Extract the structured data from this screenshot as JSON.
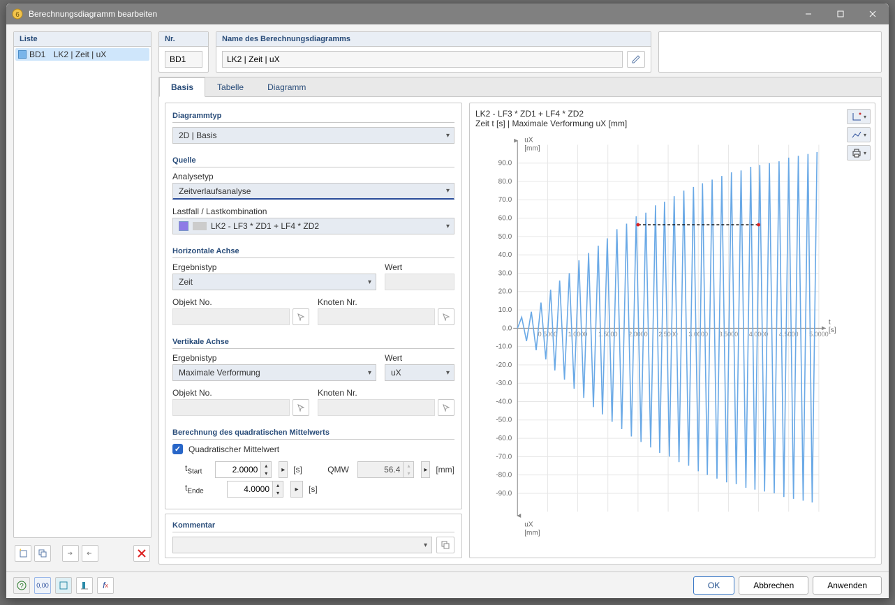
{
  "window": {
    "title": "Berechnungsdiagramm bearbeiten"
  },
  "list": {
    "title": "Liste",
    "items": [
      {
        "id": "BD1",
        "label": "LK2 | Zeit | uX"
      }
    ]
  },
  "nr": {
    "title": "Nr.",
    "value": "BD1"
  },
  "name": {
    "title": "Name des Berechnungsdiagramms",
    "value": "LK2 | Zeit | uX"
  },
  "tabs": {
    "basis": "Basis",
    "tabelle": "Tabelle",
    "diagramm": "Diagramm"
  },
  "sections": {
    "diagrammtyp": "Diagrammtyp",
    "quelle": "Quelle",
    "horiz": "Horizontale Achse",
    "vert": "Vertikale Achse",
    "rms": "Berechnung des quadratischen Mittelwerts",
    "kommentar": "Kommentar"
  },
  "fields": {
    "chart_type": "2D | Basis",
    "analysetyp_lbl": "Analysetyp",
    "analysetyp": "Zeitverlaufsanalyse",
    "lastfall_lbl": "Lastfall / Lastkombination",
    "lastfall": "LK2 - LF3 * ZD1 + LF4 * ZD2",
    "ergebnistyp_lbl": "Ergebnistyp",
    "wert_lbl": "Wert",
    "objekt_lbl": "Objekt No.",
    "knoten_lbl": "Knoten Nr.",
    "h_ergebnis": "Zeit",
    "v_ergebnis": "Maximale Verformung",
    "v_wert": "uX"
  },
  "rms": {
    "chk_label": "Quadratischer Mittelwert",
    "tstart_lbl": "t_Start",
    "tstart": "2.0000",
    "tende_lbl": "t_Ende",
    "tende": "4.0000",
    "unit_s": "[s]",
    "qmw_lbl": "QMW",
    "qmw_val": "56.4",
    "unit_mm": "[mm]"
  },
  "chart": {
    "title": "LK2 - LF3 * ZD1 + LF4 * ZD2",
    "subtitle": "Zeit t [s] | Maximale Verformung uX [mm]",
    "y_label_top": "uX",
    "y_unit": "[mm]",
    "x_label": "t",
    "x_unit": "[s]"
  },
  "footer": {
    "ok": "OK",
    "cancel": "Abbrechen",
    "apply": "Anwenden"
  },
  "chart_data": {
    "type": "line",
    "title": "LK2 - LF3 * ZD1 + LF4 * ZD2",
    "xlabel": "t [s]",
    "ylabel": "uX [mm]",
    "ylim": [
      -100,
      100
    ],
    "xlim": [
      0,
      5
    ],
    "xticks": [
      0.5,
      1.0,
      1.5,
      2.0,
      2.5,
      3.0,
      3.5,
      4.0,
      4.5,
      5.0
    ],
    "yticks": [
      -90,
      -80,
      -70,
      -60,
      -50,
      -40,
      -30,
      -20,
      -10,
      0,
      10,
      20,
      30,
      40,
      50,
      60,
      70,
      80,
      90
    ],
    "rms_line": {
      "y": 56.4,
      "x_from": 2.0,
      "x_to": 4.0
    },
    "envelope_pos": [
      [
        0.07,
        6
      ],
      [
        0.23,
        9
      ],
      [
        0.39,
        14
      ],
      [
        0.55,
        21
      ],
      [
        0.7,
        26
      ],
      [
        0.86,
        30
      ],
      [
        1.02,
        37
      ],
      [
        1.18,
        41
      ],
      [
        1.34,
        45
      ],
      [
        1.49,
        49
      ],
      [
        1.65,
        54
      ],
      [
        1.81,
        57
      ],
      [
        1.97,
        61
      ],
      [
        2.13,
        63
      ],
      [
        2.29,
        67
      ],
      [
        2.44,
        69
      ],
      [
        2.6,
        72
      ],
      [
        2.76,
        75
      ],
      [
        2.92,
        77
      ],
      [
        3.07,
        79
      ],
      [
        3.23,
        81
      ],
      [
        3.39,
        83
      ],
      [
        3.55,
        85
      ],
      [
        3.71,
        86
      ],
      [
        3.87,
        88
      ],
      [
        4.02,
        89
      ],
      [
        4.18,
        90
      ],
      [
        4.34,
        91
      ],
      [
        4.5,
        93
      ],
      [
        4.66,
        94
      ],
      [
        4.82,
        95
      ],
      [
        4.97,
        96
      ]
    ],
    "envelope_neg": [
      [
        0.15,
        -7
      ],
      [
        0.31,
        -12
      ],
      [
        0.47,
        -17
      ],
      [
        0.62,
        -23
      ],
      [
        0.78,
        -28
      ],
      [
        0.94,
        -33
      ],
      [
        1.1,
        -38
      ],
      [
        1.26,
        -43
      ],
      [
        1.41,
        -47
      ],
      [
        1.57,
        -51
      ],
      [
        1.73,
        -55
      ],
      [
        1.89,
        -59
      ],
      [
        2.05,
        -62
      ],
      [
        2.21,
        -65
      ],
      [
        2.36,
        -68
      ],
      [
        2.52,
        -70
      ],
      [
        2.68,
        -73
      ],
      [
        2.84,
        -75
      ],
      [
        3.0,
        -78
      ],
      [
        3.15,
        -80
      ],
      [
        3.31,
        -82
      ],
      [
        3.47,
        -84
      ],
      [
        3.63,
        -85
      ],
      [
        3.79,
        -87
      ],
      [
        3.94,
        -88
      ],
      [
        4.1,
        -89
      ],
      [
        4.26,
        -90
      ],
      [
        4.42,
        -92
      ],
      [
        4.58,
        -93
      ],
      [
        4.74,
        -94
      ],
      [
        4.89,
        -95
      ]
    ]
  }
}
